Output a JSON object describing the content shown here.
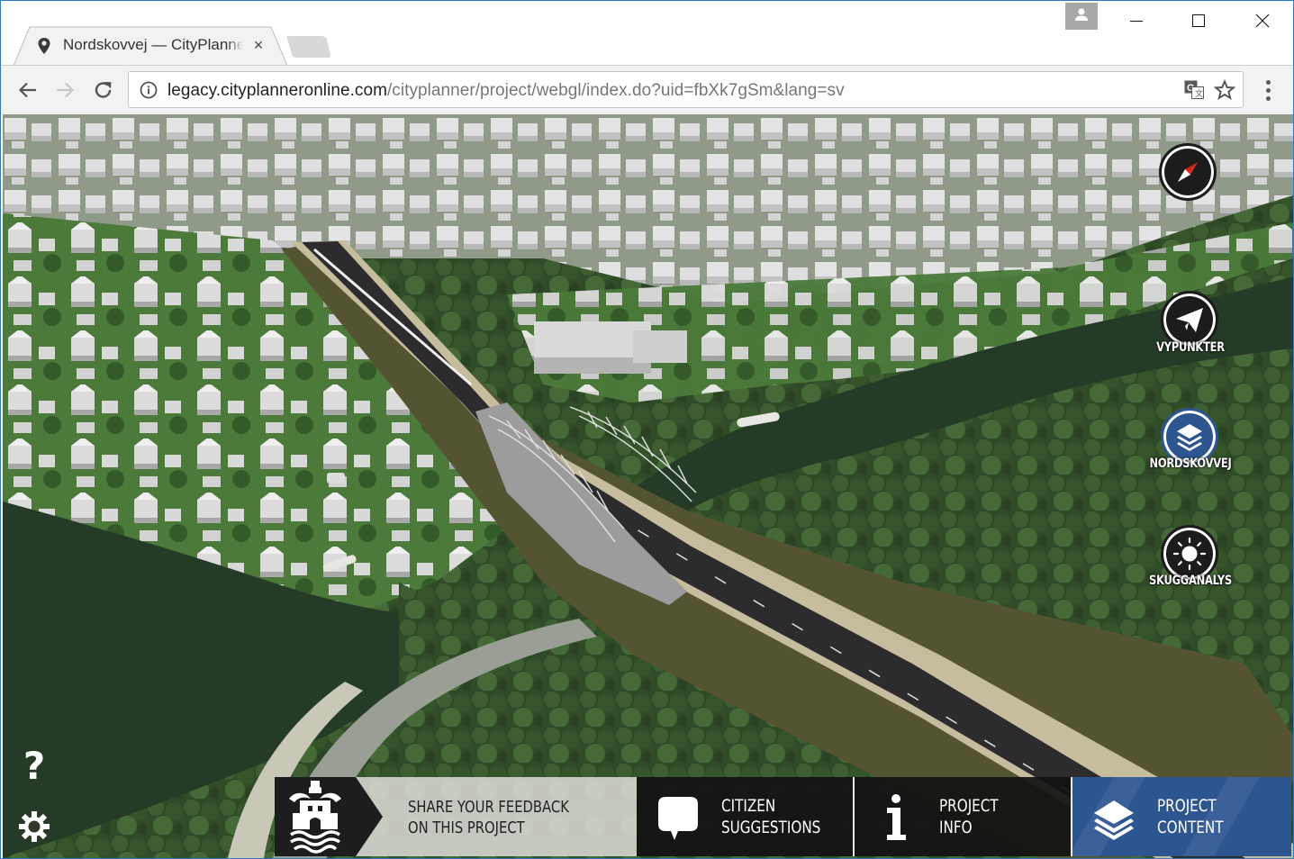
{
  "browser": {
    "tab": {
      "title": "Nordskovvej — CityPlanner",
      "favicon": "map-pin-icon",
      "close_label": "×"
    },
    "window_controls": [
      "minimize",
      "maximize",
      "close"
    ],
    "toolbar": {
      "back": "back-arrow-icon",
      "forward": "forward-arrow-icon",
      "reload": "reload-icon",
      "url_host": "legacy.cityplanneronline.com",
      "url_path": "/cityplanner/project/webgl/index.do?uid=fbXk7gSm&lang=sv",
      "translate": "translate-icon",
      "bookmark": "star-icon",
      "menu": "more-vert-icon"
    }
  },
  "app": {
    "map_controls": {
      "compass": {
        "icon": "compass-icon"
      },
      "viewpoints": {
        "label": "VYPUNKTER",
        "icon": "paper-plane-icon"
      },
      "layers": {
        "label": "NORDSKOVVEJ",
        "icon": "layers-icon",
        "active": true
      },
      "shadow": {
        "label": "SKUGGANALYS",
        "icon": "sun-icon"
      }
    },
    "left_controls": {
      "help_label": "?",
      "settings": "gear-icon"
    },
    "bottom_bar": {
      "feedback": {
        "line1": "SHARE YOUR FEEDBACK",
        "line2": "ON THIS PROJECT",
        "icon": "municipality-crest-icon"
      },
      "items": [
        {
          "line1": "CITIZEN",
          "line2": "SUGGESTIONS",
          "icon": "speech-bubble-icon"
        },
        {
          "line1": "PROJECT",
          "line2": "INFO",
          "icon": "info-icon"
        },
        {
          "line1": "PROJECT",
          "line2": "CONTENT",
          "icon": "layers-icon",
          "active": true
        }
      ]
    },
    "colors": {
      "accent_blue": "#2d5590",
      "dark_panel": "#1d1d1d",
      "compass_red": "#d9281c"
    }
  }
}
